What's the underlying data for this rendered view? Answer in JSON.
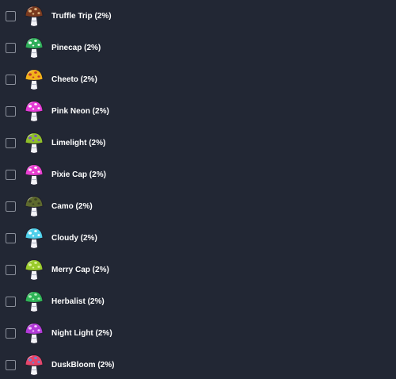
{
  "items": [
    {
      "label": "Truffle Trip (2%)",
      "icon": "mushroom-icon",
      "cap": "#7a3a1e",
      "spots": "#e3c08a",
      "checked": false
    },
    {
      "label": "Pinecap (2%)",
      "icon": "mushroom-icon",
      "cap": "#2fae5a",
      "spots": "#ffffff",
      "checked": false
    },
    {
      "label": "Cheeto (2%)",
      "icon": "mushroom-icon",
      "cap": "#f2b21a",
      "spots": "#c0392b",
      "checked": false
    },
    {
      "label": "Pink Neon (2%)",
      "icon": "mushroom-icon",
      "cap": "#e43bd6",
      "spots": "#ffffff",
      "checked": false
    },
    {
      "label": "Limelight (2%)",
      "icon": "mushroom-icon",
      "cap": "#8fbf2a",
      "spots": "#7a4fc9",
      "checked": false
    },
    {
      "label": "Pixie Cap (2%)",
      "icon": "mushroom-icon",
      "cap": "#e83fd1",
      "spots": "#ffffff",
      "checked": false
    },
    {
      "label": "Camo (2%)",
      "icon": "mushroom-icon",
      "cap": "#5e6a2e",
      "spots": "#3b3f22",
      "checked": false
    },
    {
      "label": "Cloudy (2%)",
      "icon": "mushroom-icon",
      "cap": "#4fd0ea",
      "spots": "#ffffff",
      "checked": false
    },
    {
      "label": "Merry Cap (2%)",
      "icon": "mushroom-icon",
      "cap": "#9acb2c",
      "spots": "#e0f2a0",
      "checked": false
    },
    {
      "label": "Herbalist (2%)",
      "icon": "mushroom-icon",
      "cap": "#2fb457",
      "spots": "#b9f0c2",
      "checked": false
    },
    {
      "label": "Night Light (2%)",
      "icon": "mushroom-icon",
      "cap": "#b23ad8",
      "spots": "#f6c9ff",
      "checked": false
    },
    {
      "label": "DuskBloom (2%)",
      "icon": "mushroom-icon",
      "cap": "#e7466b",
      "spots": "#5a8fe0",
      "checked": false
    }
  ]
}
